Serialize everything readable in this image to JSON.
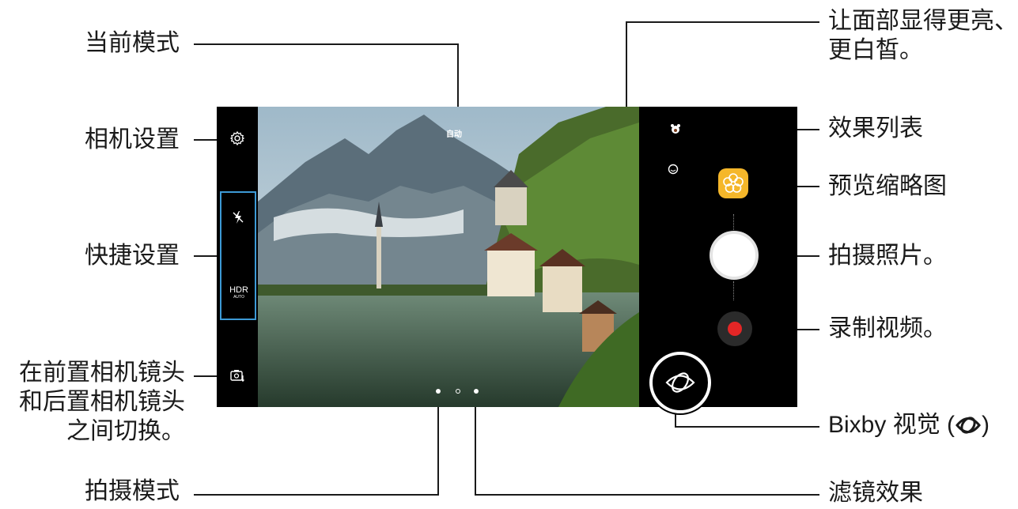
{
  "callouts": {
    "current_mode": "当前模式",
    "camera_settings": "相机设置",
    "quick_settings": "快捷设置",
    "switch_camera_line1": "在前置相机镜头",
    "switch_camera_line2": "和后置相机镜头",
    "switch_camera_line3": "之间切换。",
    "shooting_modes": "拍摄模式",
    "beauty_line1": "让面部显得更亮、",
    "beauty_line2": "更白皙。",
    "effects_list": "效果列表",
    "preview_thumbnail": "预览缩略图",
    "take_photo": "拍摄照片。",
    "record_video": "录制视频。",
    "bixby_vision": "Bixby 视觉 (",
    "bixby_vision_end": ")",
    "filters": "滤镜效果"
  },
  "screen": {
    "mode_label": "自动",
    "hdr_label": "HDR",
    "hdr_sub": "AUTO"
  },
  "icons": {
    "settings": "gear-icon",
    "flash": "flash-off-icon",
    "switch": "switch-camera-icon",
    "beauty": "face-beauty-icon",
    "effects": "bear-face-icon",
    "thumbnail": "flower-icon",
    "bixby": "bixby-eye-icon"
  },
  "colors": {
    "quick_settings_border": "#3d9ad6",
    "thumbnail_bg": "#f5b72a",
    "record_dot": "#e32626"
  }
}
